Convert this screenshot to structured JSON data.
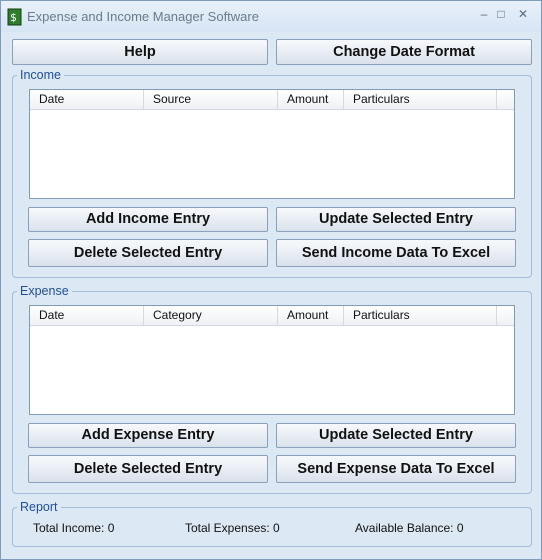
{
  "window": {
    "title": "Expense and Income Manager Software"
  },
  "toolbar": {
    "help_label": "Help",
    "change_date_label": "Change Date Format"
  },
  "income": {
    "legend": "Income",
    "columns": [
      "Date",
      "Source",
      "Amount",
      "Particulars"
    ],
    "add_label": "Add Income Entry",
    "update_label": "Update Selected Entry",
    "delete_label": "Delete Selected Entry",
    "excel_label": "Send Income Data To Excel"
  },
  "expense": {
    "legend": "Expense",
    "columns": [
      "Date",
      "Category",
      "Amount",
      "Particulars"
    ],
    "add_label": "Add Expense Entry",
    "update_label": "Update Selected Entry",
    "delete_label": "Delete Selected Entry",
    "excel_label": "Send Expense Data To Excel"
  },
  "report": {
    "legend": "Report",
    "total_income": "Total Income: 0",
    "total_expenses": "Total Expenses: 0",
    "available_balance": "Available Balance: 0"
  }
}
